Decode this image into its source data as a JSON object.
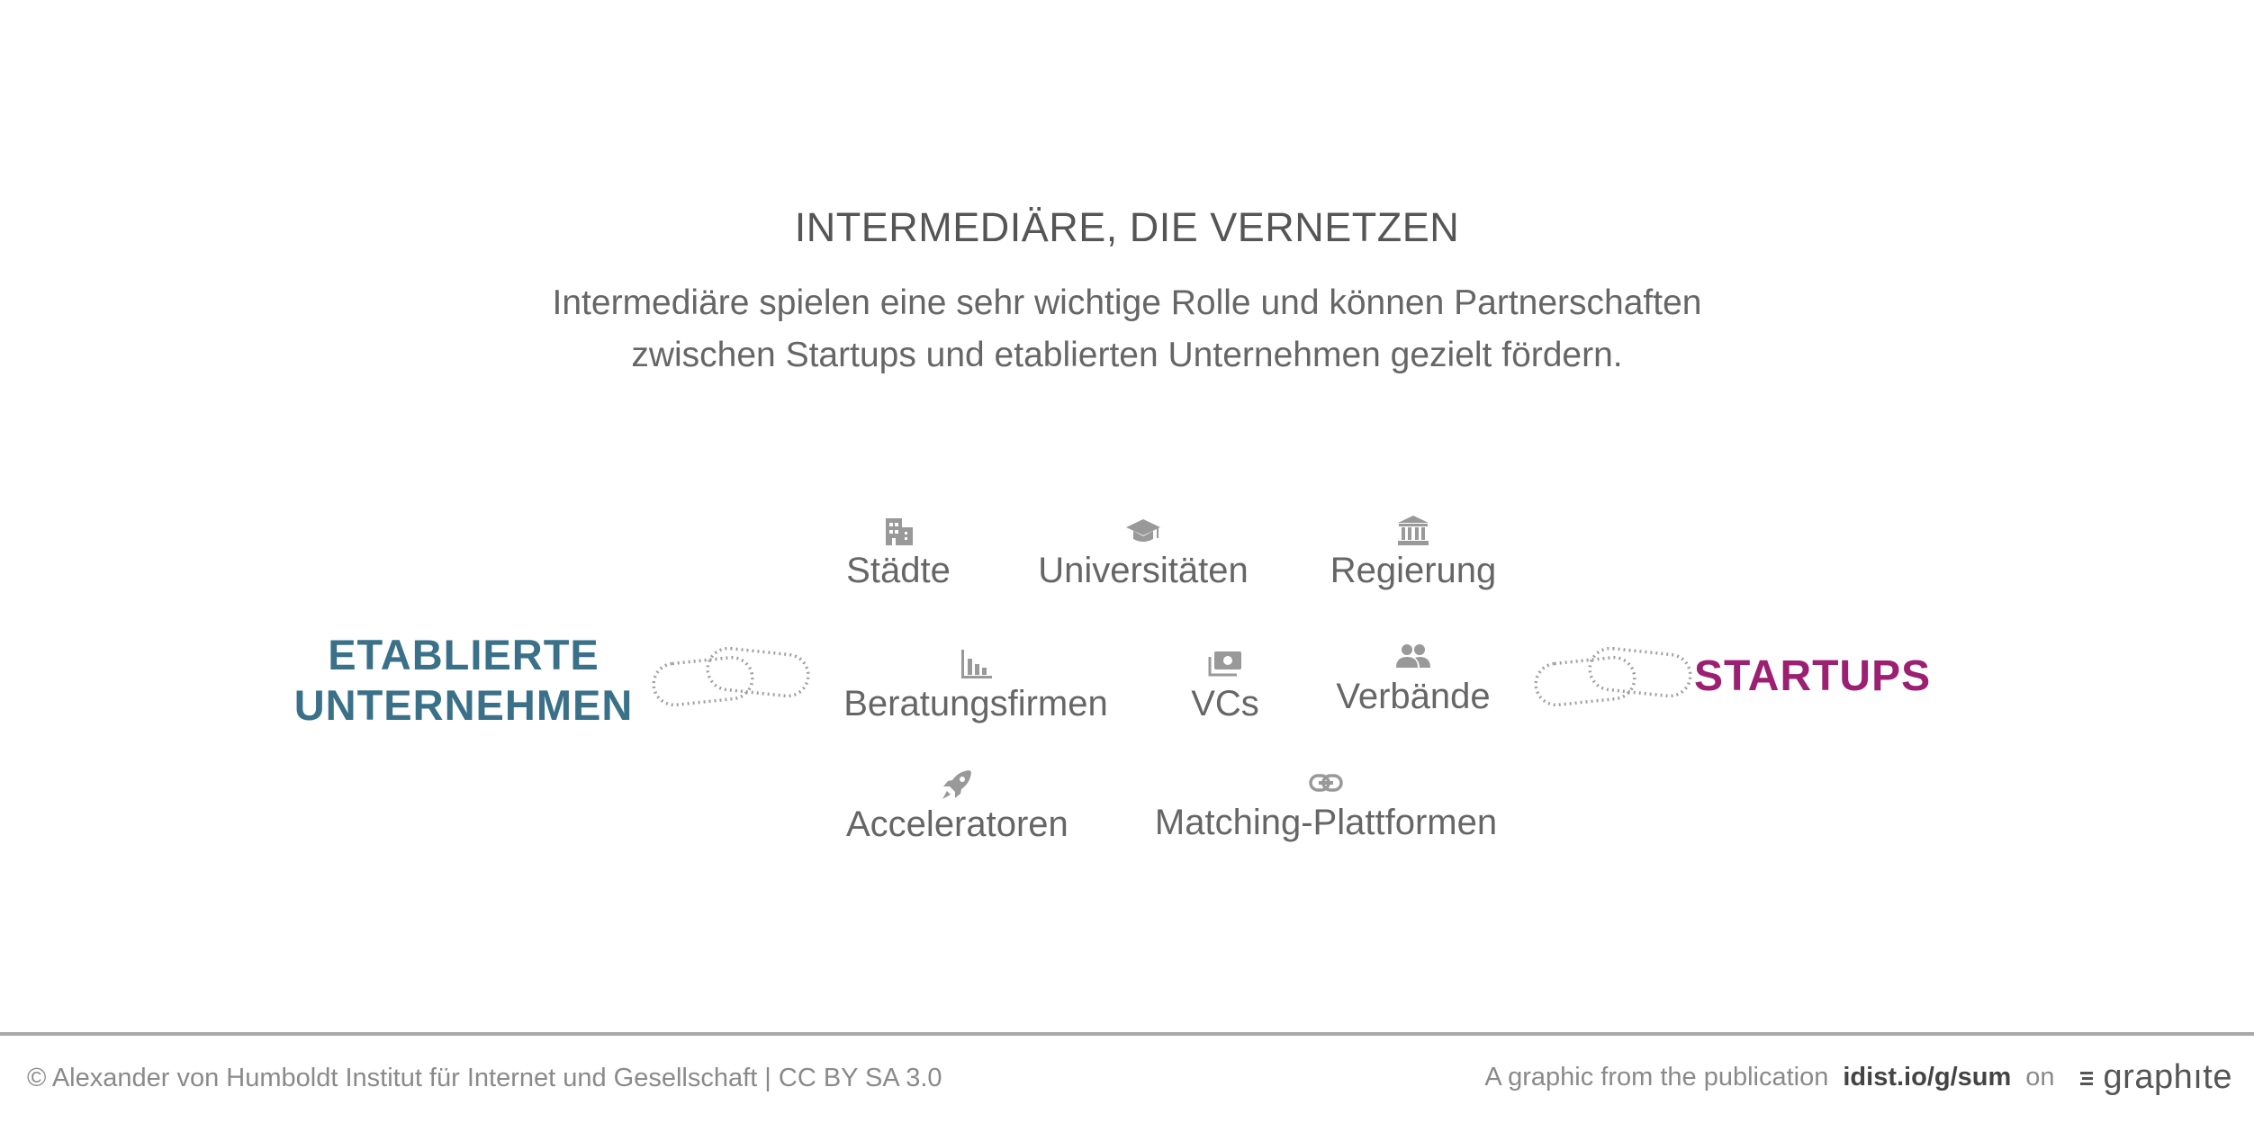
{
  "title": "INTERMEDIÄRE, DIE VERNETZEN",
  "subtitle": {
    "line1": "Intermediäre spielen eine sehr wichtige Rolle und können Partnerschaften",
    "line2": "zwischen Startups und etablierten Unternehmen gezielt fördern."
  },
  "left_entity": {
    "line1": "ETABLIERTE",
    "line2": "UNTERNEHMEN",
    "color": "#3a7189"
  },
  "right_entity": {
    "label": "STARTUPS",
    "color": "#9c1f72"
  },
  "intermediaries": [
    {
      "label": "Städte",
      "icon": "city-icon"
    },
    {
      "label": "Universitäten",
      "icon": "graduation-cap-icon"
    },
    {
      "label": "Regierung",
      "icon": "government-building-icon"
    },
    {
      "label": "Beratungsfirmen",
      "icon": "bar-chart-icon"
    },
    {
      "label": "VCs",
      "icon": "money-icon"
    },
    {
      "label": "Verbände",
      "icon": "people-icon"
    },
    {
      "label": "Acceleratoren",
      "icon": "rocket-icon"
    },
    {
      "label": "Matching-Plattformen",
      "icon": "link-icon"
    }
  ],
  "icon_color": "#999999",
  "footer": {
    "copyright": "© Alexander von Humboldt Institut für Internet und Gesellschaft | CC BY SA 3.0",
    "publication_prefix": "A graphic from the publication",
    "url": "idist.io/g/sum",
    "on": "on",
    "brand": "graphıte"
  }
}
